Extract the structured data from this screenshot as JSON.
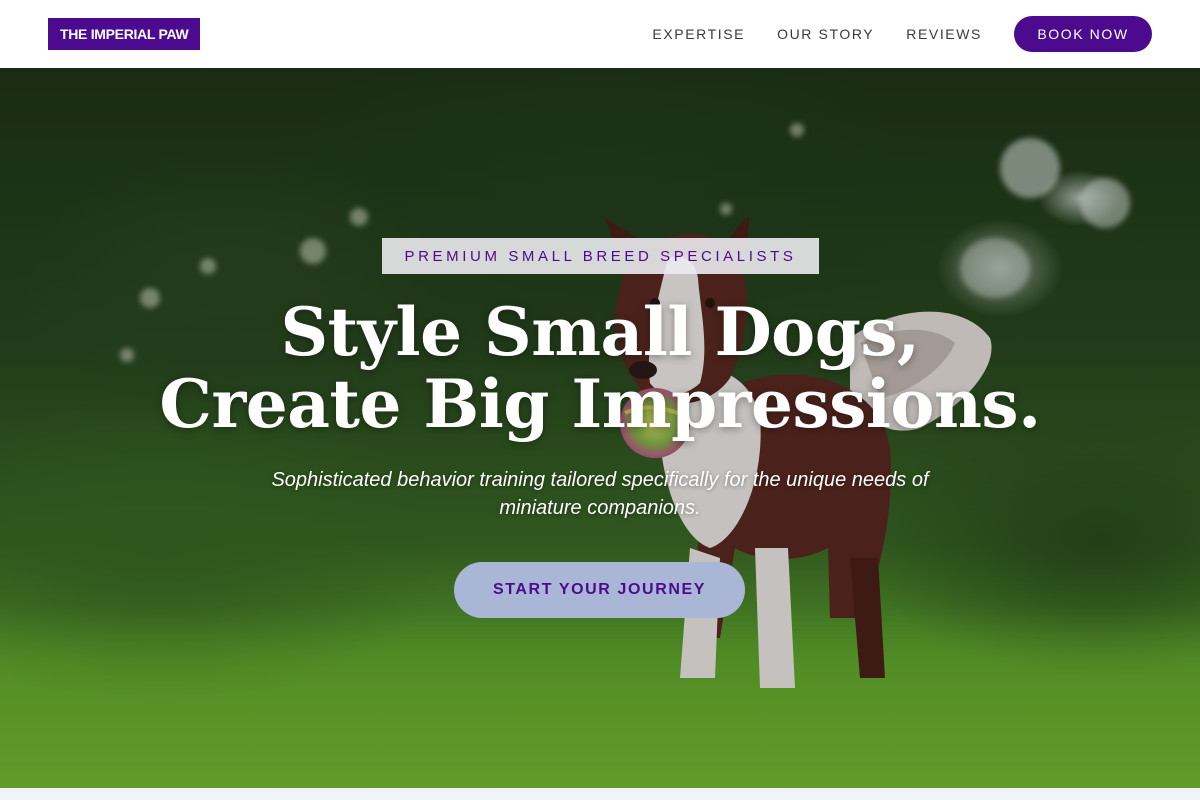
{
  "header": {
    "logo": "THE IMPERIAL PAW",
    "nav": [
      {
        "label": "EXPERTISE"
      },
      {
        "label": "OUR STORY"
      },
      {
        "label": "REVIEWS"
      }
    ],
    "book_label": "BOOK NOW"
  },
  "hero": {
    "badge": "PREMIUM SMALL BREED SPECIALISTS",
    "headline_line1": "Style Small Dogs,",
    "headline_line2": "Create Big Impressions.",
    "subtext": "Sophisticated behavior training tailored specifically for the unique needs of miniature companions.",
    "cta_label": "START YOUR JOURNEY"
  },
  "colors": {
    "brand": "#4c0b8f",
    "cta_bg": "#a9b6d6",
    "badge_bg": "#ebebee",
    "header_bg": "#ffffff"
  },
  "icons": {
    "hero_image": "dog-running-with-ball-photo"
  }
}
